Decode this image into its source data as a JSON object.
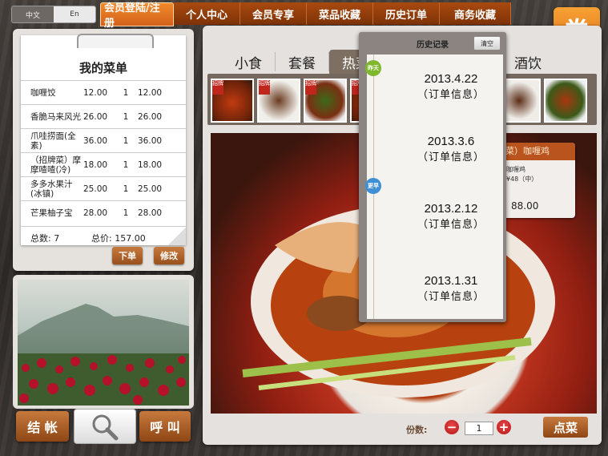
{
  "language": {
    "chinese": "中文",
    "english": "En"
  },
  "nav": {
    "items": [
      "会员登陆/注册",
      "个人中心",
      "会员专享",
      "菜品收藏",
      "历史订单",
      "商务收藏"
    ]
  },
  "coupon": {
    "label": "券"
  },
  "my_menu": {
    "title": "我的菜单",
    "rows": [
      {
        "name": "咖喱饺",
        "price": "12.00",
        "qty": "1",
        "total": "12.00"
      },
      {
        "name": "香脆马来风光",
        "price": "26.00",
        "qty": "1",
        "total": "26.00"
      },
      {
        "name": "爪哇捞面(全素)",
        "price": "36.00",
        "qty": "1",
        "total": "36.00"
      },
      {
        "name": "（招牌菜）摩摩喳喳(冷)",
        "price": "18.00",
        "qty": "1",
        "total": "18.00"
      },
      {
        "name": "多多水果汁(冰镇)",
        "price": "25.00",
        "qty": "1",
        "total": "25.00"
      },
      {
        "name": "芒果柚子宝",
        "price": "28.00",
        "qty": "1",
        "total": "28.00"
      }
    ],
    "total_count_label": "总数:  7",
    "total_price_label": "总价: 157.00",
    "order_button": "下单",
    "edit_button": "修改"
  },
  "bottom_buttons": {
    "checkout": "结 帐",
    "call": "呼 叫"
  },
  "tabs": [
    "小食",
    "套餐",
    "热菜",
    "酒饮"
  ],
  "thumb_tag": "招牌",
  "dish_card": {
    "header": "牌菜）咖喱鸡",
    "name": "咖喱鸡",
    "price_small": "¥48（中）",
    "price": "88.00"
  },
  "quantity": {
    "label": "份数:",
    "minus": "−",
    "plus": "+",
    "value": "1"
  },
  "order_dish_button": "点菜",
  "history": {
    "title": "历史记录",
    "clear_button": "清空",
    "tag_yesterday": "昨天",
    "tag_earlier": "更早",
    "items": [
      {
        "date": "2013.4.22",
        "info": "（订单信息）"
      },
      {
        "date": "2013.3.6",
        "info": "（订单信息）"
      },
      {
        "date": "2013.2.12",
        "info": "（订单信息）"
      },
      {
        "date": "2013.1.31",
        "info": "（订单信息）"
      }
    ]
  },
  "colors": {
    "nav_accent": "#e37321",
    "nav_bar": "#8f3c09",
    "button": "#b36530",
    "history_dot_green": "#7fb82c",
    "history_dot_blue": "#3f8fd6"
  }
}
